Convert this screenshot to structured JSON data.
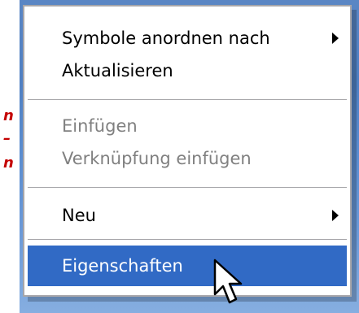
{
  "context_menu": {
    "items": [
      {
        "label": "Symbole anordnen nach",
        "submenu": true,
        "enabled": true
      },
      {
        "label": "Aktualisieren",
        "submenu": false,
        "enabled": true
      },
      {
        "label": "Einfügen",
        "submenu": false,
        "enabled": false
      },
      {
        "label": "Verknüpfung einfügen",
        "submenu": false,
        "enabled": false
      },
      {
        "label": "Neu",
        "submenu": true,
        "enabled": true
      },
      {
        "label": "Eigenschaften",
        "submenu": false,
        "enabled": true,
        "highlighted": true
      }
    ]
  },
  "colors": {
    "highlight": "#316ac5",
    "disabled_text": "#808080",
    "menu_border": "#a7a6aa",
    "annotation": "#c40000"
  },
  "icons": {
    "submenu_arrow": "triangle-right",
    "cursor": "arrow-pointer"
  }
}
